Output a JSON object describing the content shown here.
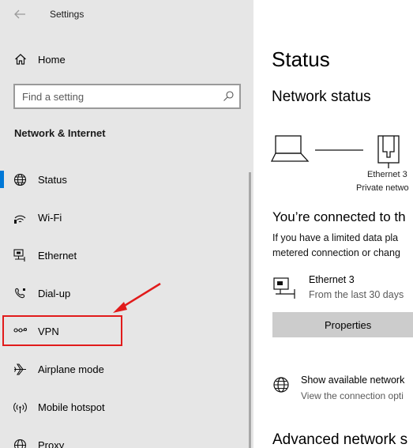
{
  "window": {
    "title": "Settings"
  },
  "sidebar": {
    "home_label": "Home",
    "search_placeholder": "Find a setting",
    "section_title": "Network & Internet",
    "items": [
      {
        "label": "Status",
        "icon": "globe-icon",
        "active": true
      },
      {
        "label": "Wi-Fi",
        "icon": "wifi-icon"
      },
      {
        "label": "Ethernet",
        "icon": "ethernet-icon"
      },
      {
        "label": "Dial-up",
        "icon": "dialup-icon"
      },
      {
        "label": "VPN",
        "icon": "vpn-icon"
      },
      {
        "label": "Airplane mode",
        "icon": "airplane-icon"
      },
      {
        "label": "Mobile hotspot",
        "icon": "hotspot-icon"
      },
      {
        "label": "Proxy",
        "icon": "globe-icon"
      }
    ]
  },
  "main": {
    "page_title": "Status",
    "network_status_title": "Network status",
    "diagram": {
      "adapter_name": "Ethernet 3",
      "network_type": "Private netwo"
    },
    "connected_heading": "You’re connected to th",
    "description_line1": "If you have a limited data pla",
    "description_line2": "metered connection or chang",
    "adapter": {
      "name": "Ethernet 3",
      "usage": "From the last 30 days"
    },
    "properties_label": "Properties",
    "show_networks": {
      "title": "Show available network",
      "desc": "View the connection opti"
    },
    "advanced_heading": "Advanced network s"
  },
  "colors": {
    "accent": "#0078d7",
    "annotation": "#e11b1b",
    "sidebar_bg": "#e6e6e6"
  }
}
